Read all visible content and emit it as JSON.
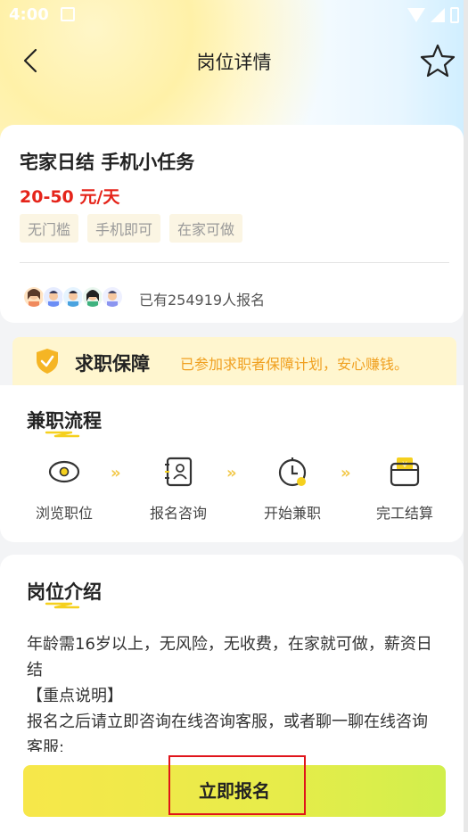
{
  "status_bar": {
    "time": "4:00"
  },
  "header": {
    "title": "岗位详情"
  },
  "job": {
    "title": "宅家日结 手机小任务",
    "salary": "20-50 元/天",
    "tags": [
      "无门槛",
      "手机即可",
      "在家可做"
    ],
    "signup_count": "已有254919人报名"
  },
  "guarantee": {
    "title": "求职保障",
    "description": "已参加求职者保障计划，安心赚钱。"
  },
  "process": {
    "title": "兼职流程",
    "steps": [
      {
        "label": "浏览职位",
        "icon": "eye-icon"
      },
      {
        "label": "报名咨询",
        "icon": "profile-card-icon"
      },
      {
        "label": "开始兼职",
        "icon": "clock-icon"
      },
      {
        "label": "完工结算",
        "icon": "wallet-icon"
      }
    ]
  },
  "intro": {
    "title": "岗位介绍",
    "text": "年龄需16岁以上，无风险，无收费，在家就可做，薪资日结\n【重点说明】\n报名之后请立即咨询在线咨询客服，或者聊一聊在线咨询客服;"
  },
  "actions": {
    "apply_label": "立即报名"
  },
  "colors": {
    "salary": "#e5241a",
    "guarantee_text": "#f0a020",
    "apply_button": "#f7e74a",
    "highlight": "#e0141a"
  }
}
